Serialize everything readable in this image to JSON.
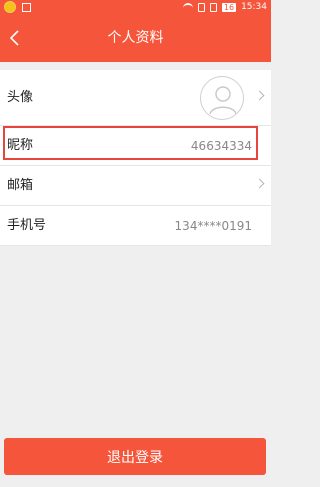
{
  "status_bar": {
    "battery": "16",
    "time": "15:34"
  },
  "header": {
    "title": "个人资料",
    "back_icon": "chevron-left-icon"
  },
  "profile": {
    "rows": [
      {
        "label": "头像",
        "value": ""
      },
      {
        "label": "昵称",
        "value": "46634334"
      },
      {
        "label": "邮箱",
        "value": ""
      },
      {
        "label": "手机号",
        "value": "134****0191"
      }
    ]
  },
  "actions": {
    "logout_label": "退出登录"
  },
  "colors": {
    "accent": "#f5553a",
    "highlight_border": "#e8443b"
  }
}
